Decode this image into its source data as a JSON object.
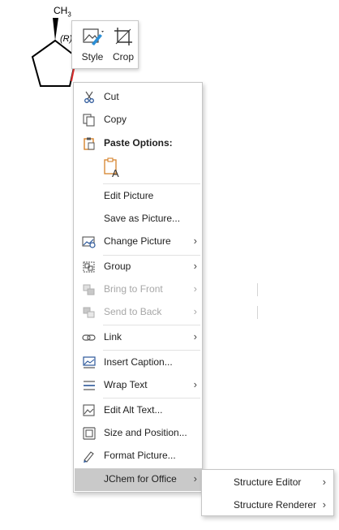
{
  "structure": {
    "methyl_label": "CH",
    "methyl_subscript": "3",
    "stereo_label": "(R)"
  },
  "mini_toolbar": {
    "style_label": "Style",
    "crop_label": "Crop"
  },
  "menu": {
    "cut": "Cut",
    "copy": "Copy",
    "paste_options": "Paste Options:",
    "edit_picture": "Edit Picture",
    "save_as_picture": "Save as Picture...",
    "change_picture": "Change Picture",
    "group": "Group",
    "bring_to_front": "Bring to Front",
    "send_to_back": "Send to Back",
    "link": "Link",
    "insert_caption": "Insert Caption...",
    "wrap_text": "Wrap Text",
    "edit_alt_text": "Edit Alt Text...",
    "size_and_position": "Size and Position...",
    "format_picture": "Format Picture...",
    "jchem": "JChem for Office"
  },
  "submenu": {
    "structure_editor": "Structure Editor",
    "structure_renderer": "Structure Renderer"
  },
  "colors": {
    "highlight": "#c9c9c9",
    "disabled_text": "#a7a7a7",
    "icon_blue": "#2b579a",
    "paste_orange": "#d5822b"
  }
}
